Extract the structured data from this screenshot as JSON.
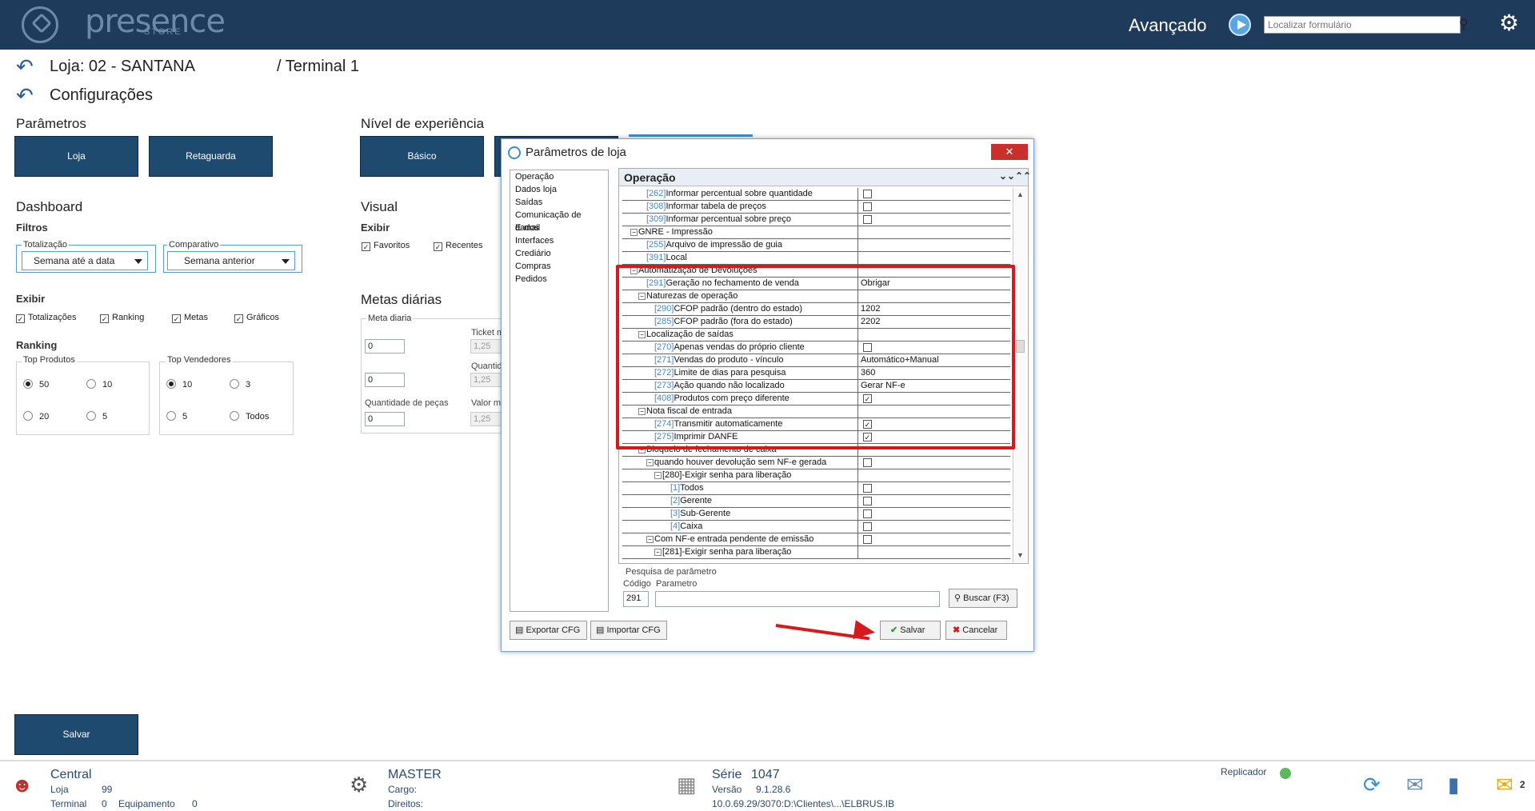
{
  "header": {
    "logo_text": "presence",
    "logo_sub": "STORE",
    "advanced_label": "Avançado",
    "search_placeholder": "Localizar formulário"
  },
  "breadcrumb": {
    "store": "Loja: 02 - SANTANA",
    "terminal": "/ Terminal 1",
    "config": "Configurações"
  },
  "parametros": {
    "title": "Parâmetros",
    "btn_loja": "Loja",
    "btn_retaguarda": "Retaguarda"
  },
  "nivel": {
    "title": "Nível de experiência",
    "btn_basico": "Básico"
  },
  "dashboard": {
    "title": "Dashboard",
    "filtros": "Filtros",
    "totalizacao_label": "Totalização",
    "totalizacao_value": "Semana até a data",
    "comparativo_label": "Comparativo",
    "comparativo_value": "Semana anterior",
    "exibir": "Exibir",
    "exibir_items": [
      "Totalizações",
      "Ranking",
      "Metas",
      "Gráficos"
    ],
    "ranking": "Ranking",
    "top_produtos": "Top Produtos",
    "top_vendedores": "Top Vendedores",
    "prod_opts": [
      "50",
      "10",
      "20",
      "5"
    ],
    "vend_opts": [
      "10",
      "3",
      "5",
      "Todos"
    ]
  },
  "visual": {
    "title": "Visual",
    "exibir": "Exibir",
    "favoritos": "Favoritos",
    "recentes": "Recentes"
  },
  "metas": {
    "title": "Metas diárias",
    "meta_diaria": "Meta diaria",
    "ticket": "Ticket m",
    "quantid": "Quantid",
    "qtd_pecas": "Quantidade de peças",
    "valor": "Valor m",
    "v1": "0",
    "v2": "0",
    "v3": "0",
    "d1": "1,25",
    "d2": "1,25",
    "d3": "1,25"
  },
  "save_label": "Salvar",
  "dialog": {
    "title": "Parâmetros de loja",
    "menu": [
      "Operação",
      "Dados loja",
      "Saídas",
      "Comunicação de dados",
      "E-mail",
      "Interfaces",
      "Crediário",
      "Compras",
      "Pedidos"
    ],
    "section": "Operação",
    "rows": [
      {
        "indent": 30,
        "code": "[262]",
        "name": "Informar percentual sobre quantidade",
        "check": false,
        "value": ""
      },
      {
        "indent": 30,
        "code": "[308]",
        "name": "Informar tabela de preços",
        "check": false,
        "value": ""
      },
      {
        "indent": 30,
        "code": "[309]",
        "name": "Informar percentual sobre preço",
        "check": false,
        "value": ""
      },
      {
        "indent": 10,
        "toggle": "⊟",
        "code": "",
        "name": "GNRE - Impressão",
        "value": ""
      },
      {
        "indent": 30,
        "code": "[255]",
        "name": "Arquivo de impressão de guia",
        "value": ""
      },
      {
        "indent": 30,
        "code": "[391]",
        "name": "Local",
        "value": ""
      },
      {
        "indent": 10,
        "toggle": "⊟",
        "code": "",
        "name": "Automatização de Devoluções",
        "value": ""
      },
      {
        "indent": 30,
        "code": "[291]",
        "name": "Geração no fechamento de venda",
        "value": "Obrigar"
      },
      {
        "indent": 20,
        "toggle": "⊟",
        "code": "",
        "name": "Naturezas de operação",
        "value": ""
      },
      {
        "indent": 40,
        "code": "[290]",
        "name": "CFOP padrão (dentro do estado)",
        "value": "1202"
      },
      {
        "indent": 40,
        "code": "[285]",
        "name": "CFOP padrão (fora do estado)",
        "value": "2202"
      },
      {
        "indent": 20,
        "toggle": "⊟",
        "code": "",
        "name": "Localização de saídas",
        "value": ""
      },
      {
        "indent": 40,
        "code": "[270]",
        "name": "Apenas vendas do próprio cliente",
        "check": false,
        "value": ""
      },
      {
        "indent": 40,
        "code": "[271]",
        "name": "Vendas do produto - vínculo",
        "value": "Automático+Manual"
      },
      {
        "indent": 40,
        "code": "[272]",
        "name": "Limite de dias para pesquisa",
        "value": "360"
      },
      {
        "indent": 40,
        "code": "[273]",
        "name": "Ação quando não localizado",
        "value": "Gerar NF-e"
      },
      {
        "indent": 40,
        "code": "[408]",
        "name": "Produtos com preço diferente",
        "check": true,
        "value": ""
      },
      {
        "indent": 20,
        "toggle": "⊟",
        "code": "",
        "name": "Nota fiscal de entrada",
        "value": ""
      },
      {
        "indent": 40,
        "code": "[274]",
        "name": "Transmitir automaticamente",
        "check": true,
        "value": ""
      },
      {
        "indent": 40,
        "code": "[275]",
        "name": "Imprimir DANFE",
        "check": true,
        "value": ""
      },
      {
        "indent": 20,
        "toggle": "⊟",
        "code": "",
        "name": "Bloqueio de fechamento de caixa",
        "value": ""
      },
      {
        "indent": 30,
        "toggle": "⊟",
        "code": "",
        "name": "quando houver devolução sem NF-e gerada",
        "check": false,
        "value": ""
      },
      {
        "indent": 40,
        "toggle": "⊟",
        "code": "",
        "name": "[280]-Exigir senha para liberação",
        "value": ""
      },
      {
        "indent": 60,
        "code": "[1]",
        "name": "Todos",
        "check": false,
        "value": ""
      },
      {
        "indent": 60,
        "code": "[2]",
        "name": "Gerente",
        "check": false,
        "value": ""
      },
      {
        "indent": 60,
        "code": "[3]",
        "name": "Sub-Gerente",
        "check": false,
        "value": ""
      },
      {
        "indent": 60,
        "code": "[4]",
        "name": "Caixa",
        "check": false,
        "value": ""
      },
      {
        "indent": 30,
        "toggle": "⊟",
        "code": "",
        "name": "Com NF-e entrada pendente de emissão",
        "check": false,
        "value": ""
      },
      {
        "indent": 40,
        "toggle": "⊟",
        "code": "",
        "name": "[281]-Exigir senha para liberação",
        "value": ""
      }
    ],
    "pesquisa": "Pesquisa de parâmetro",
    "codigo_label": "Código",
    "parametro_label": "Parametro",
    "codigo_value": "291",
    "parametro_value": "",
    "buscar": "Buscar (F3)",
    "exportar": "Exportar CFG",
    "importar": "Importar CFG",
    "salvar": "Salvar",
    "cancelar": "Cancelar"
  },
  "footer": {
    "central": "Central",
    "loja_label": "Loja",
    "loja_value": "99",
    "terminal_label": "Terminal",
    "terminal_value": "0",
    "equip_label": "Equipamento",
    "equip_value": "0",
    "master": "MASTER",
    "cargo": "Cargo:",
    "direitos": "Direitos:",
    "serie_label": "Série",
    "serie_value": "1047",
    "versao_label": "Versão",
    "versao_value": "9.1.28.6",
    "path": "10.0.69.29/3070:D:\\Clientes\\...\\ELBRUS.IB",
    "replicador": "Replicador",
    "msg_count": "2"
  }
}
